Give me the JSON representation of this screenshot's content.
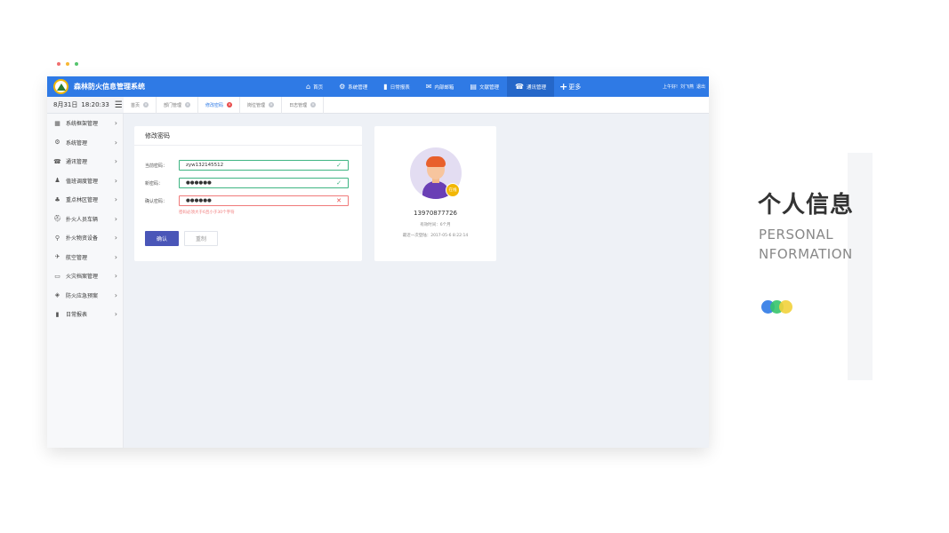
{
  "window_dots": [
    "#f06e6e",
    "#f7b733",
    "#54c46d"
  ],
  "app": {
    "title": "森林防火信息管理系统",
    "nav": [
      {
        "label": "首页",
        "icon": "home-icon",
        "glyph": "⌂"
      },
      {
        "label": "系统管理",
        "icon": "gear-icon",
        "glyph": "⚙"
      },
      {
        "label": "日常报表",
        "icon": "bar-chart-icon",
        "glyph": "▮"
      },
      {
        "label": "内部邮箱",
        "icon": "mail-icon",
        "glyph": "✉"
      },
      {
        "label": "文献管理",
        "icon": "document-icon",
        "glyph": "▤"
      },
      {
        "label": "通讯管理",
        "icon": "phone-book-icon",
        "glyph": "☎"
      }
    ],
    "more_label": "更多",
    "user_greeting": "上午好!",
    "user_name": "刘飞燕",
    "logout_label": "退出",
    "date": "8月31日",
    "time": "18:20:33"
  },
  "tabs": [
    {
      "label": "首页",
      "active": false
    },
    {
      "label": "部门管理",
      "active": false
    },
    {
      "label": "修改密码",
      "active": true
    },
    {
      "label": "岗位管理",
      "active": false
    },
    {
      "label": "日志管理",
      "active": false
    }
  ],
  "sidebar": {
    "items": [
      {
        "label": "系统框架管理",
        "icon": "grid-icon",
        "glyph": "▦"
      },
      {
        "label": "系统管理",
        "icon": "gear-icon",
        "glyph": "⚙"
      },
      {
        "label": "通讯管理",
        "icon": "phone-book-icon",
        "glyph": "☎"
      },
      {
        "label": "值班调度管理",
        "icon": "person-icon",
        "glyph": "♟"
      },
      {
        "label": "重点林区管理",
        "icon": "tree-icon",
        "glyph": "♣"
      },
      {
        "label": "扑火人员车辆",
        "icon": "helmet-icon",
        "glyph": "⛑"
      },
      {
        "label": "扑火物资设备",
        "icon": "extinguisher-icon",
        "glyph": "⚲"
      },
      {
        "label": "航空管理",
        "icon": "airplane-icon",
        "glyph": "✈"
      },
      {
        "label": "火灾档案管理",
        "icon": "folder-icon",
        "glyph": "▭"
      },
      {
        "label": "防火应急预案",
        "icon": "shield-icon",
        "glyph": "◈"
      },
      {
        "label": "日常报表",
        "icon": "bar-chart-icon",
        "glyph": "▮"
      }
    ]
  },
  "password_form": {
    "title": "修改密码",
    "current_label": "当前密码：",
    "current_value": "zyw132145512",
    "new_label": "新密码：",
    "new_value": "●●●●●●",
    "confirm_label": "确认密码：",
    "confirm_value": "●●●●●●",
    "error_message": "密码必须大于6且小于30个字符",
    "ok_label": "确认",
    "reset_label": "重制",
    "valid_glyph": "✓",
    "invalid_glyph": "✕"
  },
  "profile": {
    "badge": "在线",
    "phone": "13970877726",
    "validity": "有效时间：6个月",
    "last_login": "最近一次登陆：2017-05-6 8:22:14"
  },
  "hero": {
    "title": "个人信息",
    "subtitle_line1": "PERSONAL",
    "subtitle_line2": "NFORMATION"
  },
  "colors": {
    "primary": "#2f7ae5",
    "success": "#3fb583",
    "error": "#e84a4a",
    "button": "#4a56b8",
    "circles": [
      "#2f7ae5",
      "#36c46b",
      "#f2d23b"
    ]
  }
}
